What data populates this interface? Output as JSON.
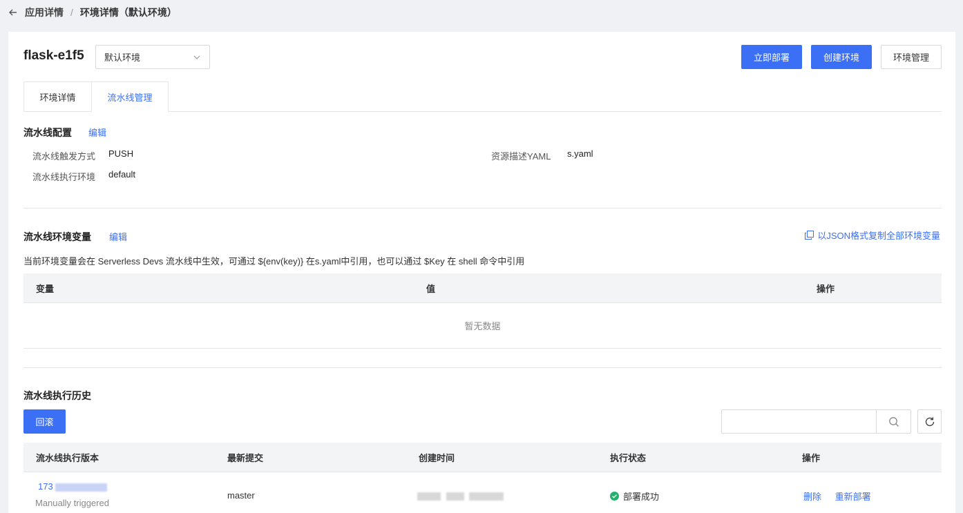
{
  "breadcrumb": {
    "parent": "应用详情",
    "separator": "/",
    "current": "环境详情（默认环境）"
  },
  "header": {
    "app_name": "flask-e1f5",
    "env_select": "默认环境",
    "buttons": {
      "deploy": "立即部署",
      "create_env": "创建环境",
      "manage_env": "环境管理"
    }
  },
  "tabs": [
    {
      "label": "环境详情"
    },
    {
      "label": "流水线管理"
    }
  ],
  "active_tab": "流水线管理",
  "pipeline_config": {
    "title": "流水线配置",
    "edit": "编辑",
    "trigger_label": "流水线触发方式",
    "trigger_value": "PUSH",
    "exec_env_label": "流水线执行环境",
    "exec_env_value": "default",
    "yaml_label": "资源描述YAML",
    "yaml_value": "s.yaml"
  },
  "env_vars": {
    "title": "流水线环境变量",
    "edit": "编辑",
    "copy_json": "以JSON格式复制全部环境变量",
    "hint": "当前环境变量会在 Serverless Devs 流水线中生效，可通过 ${env(key)} 在s.yaml中引用，也可以通过 $Key 在 shell 命令中引用",
    "columns": [
      "变量",
      "值",
      "操作"
    ],
    "empty_text": "暂无数据"
  },
  "history": {
    "title": "流水线执行历史",
    "rollback": "回滚",
    "search_placeholder": "",
    "columns": [
      "流水线执行版本",
      "最新提交",
      "创建时间",
      "执行状态",
      "操作"
    ],
    "rows": [
      {
        "version": "173",
        "trigger": "Manually triggered",
        "commit": "master",
        "status": "部署成功",
        "actions": [
          "删除",
          "重新部署"
        ]
      }
    ]
  },
  "colors": {
    "primary": "#3b6ff5",
    "success": "#23b26d",
    "border": "#e5e5e5",
    "header_bg": "#f3f4f6"
  }
}
